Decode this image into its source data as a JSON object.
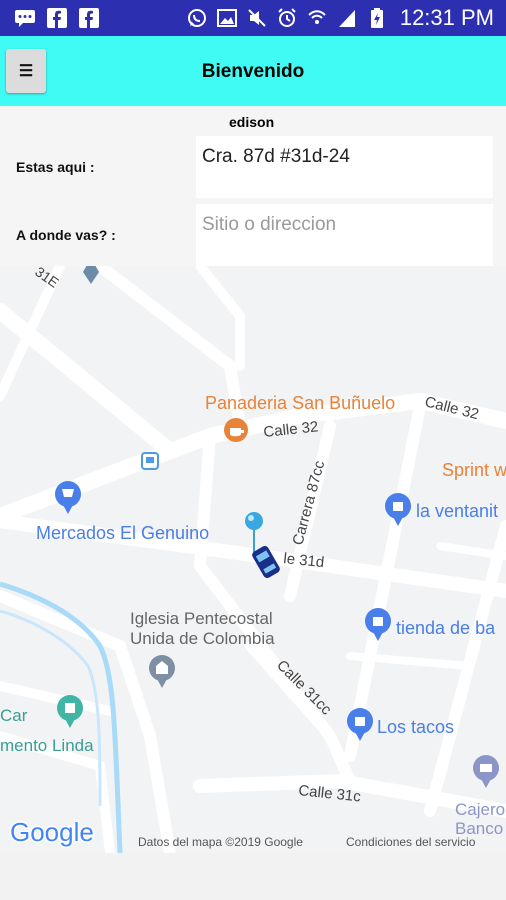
{
  "status_bar": {
    "time": "12:31 PM",
    "left_icons": [
      "chat-icon",
      "facebook-icon",
      "facebook-icon"
    ],
    "right_icons": [
      "whatsapp-icon",
      "image-icon",
      "mute-icon",
      "alarm-icon",
      "wifi-icon",
      "signal-icon",
      "battery-icon"
    ]
  },
  "app_bar": {
    "menu_icon": "☰",
    "title": "Bienvenido"
  },
  "form": {
    "username": "edison",
    "origin_label": "Estas aqui :",
    "origin_value": "Cra. 87d #31d-24",
    "destination_label": "A donde vas? :",
    "destination_placeholder": "Sitio o direccion"
  },
  "map": {
    "labels": {
      "l31e": "31E",
      "panaderia": "Panaderia San Buñuelo",
      "calle32a": "Calle 32",
      "calle32b": "Calle 32",
      "carrera87cc": "Carrera 87cc",
      "sprint": "Sprint w",
      "ventanita": "la ventanit",
      "mercados": "Mercados El Genuino",
      "calle31d": "le 31d",
      "iglesia1": "Iglesia Pentecostal",
      "iglesia2": "Unida de Colombia",
      "tienda": "tienda de ba",
      "calle31cc": "Calle 31cc",
      "car": "Car",
      "mento": "mento Linda",
      "lostacos": "Los tacos",
      "calle31c": "Calle 31c",
      "cajero1": "Cajero",
      "cajero2": "Banco",
      "google": "Google",
      "attribution": "Datos del mapa ©2019 Google",
      "terms": "Condiciones del servicio"
    },
    "colors": {
      "poi_orange": "#e8833a",
      "poi_blue": "#4a7ee8",
      "road_label": "#444444"
    }
  }
}
